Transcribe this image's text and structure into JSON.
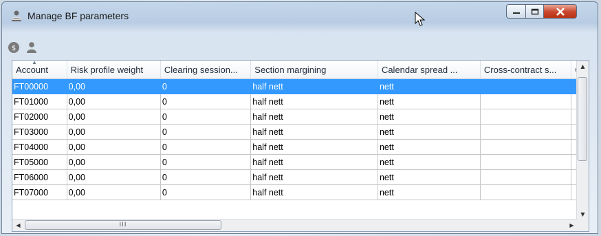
{
  "window": {
    "title": "Manage BF parameters",
    "controls": {
      "minimize": "minimize",
      "maximize": "maximize",
      "close": "close"
    }
  },
  "toolbar": {
    "buttons": [
      {
        "name": "calculate-icon",
        "tooltip": ""
      },
      {
        "name": "user-icon",
        "tooltip": ""
      }
    ]
  },
  "grid": {
    "columns": [
      "Account",
      "Risk profile weight",
      "Clearing session...",
      "Section margining",
      "Calendar spread ...",
      "Cross-contract s...",
      "C"
    ],
    "rows": [
      [
        "FT00000",
        "0,00",
        "0",
        "half nett",
        "nett",
        "",
        ""
      ],
      [
        "FT01000",
        "0,00",
        "0",
        "half nett",
        "nett",
        "",
        ""
      ],
      [
        "FT02000",
        "0,00",
        "0",
        "half nett",
        "nett",
        "",
        ""
      ],
      [
        "FT03000",
        "0,00",
        "0",
        "half nett",
        "nett",
        "",
        ""
      ],
      [
        "FT04000",
        "0,00",
        "0",
        "half nett",
        "nett",
        "",
        ""
      ],
      [
        "FT05000",
        "0,00",
        "0",
        "half nett",
        "nett",
        "",
        ""
      ],
      [
        "FT06000",
        "0,00",
        "0",
        "half nett",
        "nett",
        "",
        ""
      ],
      [
        "FT07000",
        "0,00",
        "0",
        "half nett",
        "nett",
        "",
        ""
      ]
    ],
    "selected_row": 0,
    "sorted_column": "Account"
  },
  "colors": {
    "selection": "#3399ff",
    "close_button": "#c9452c"
  }
}
